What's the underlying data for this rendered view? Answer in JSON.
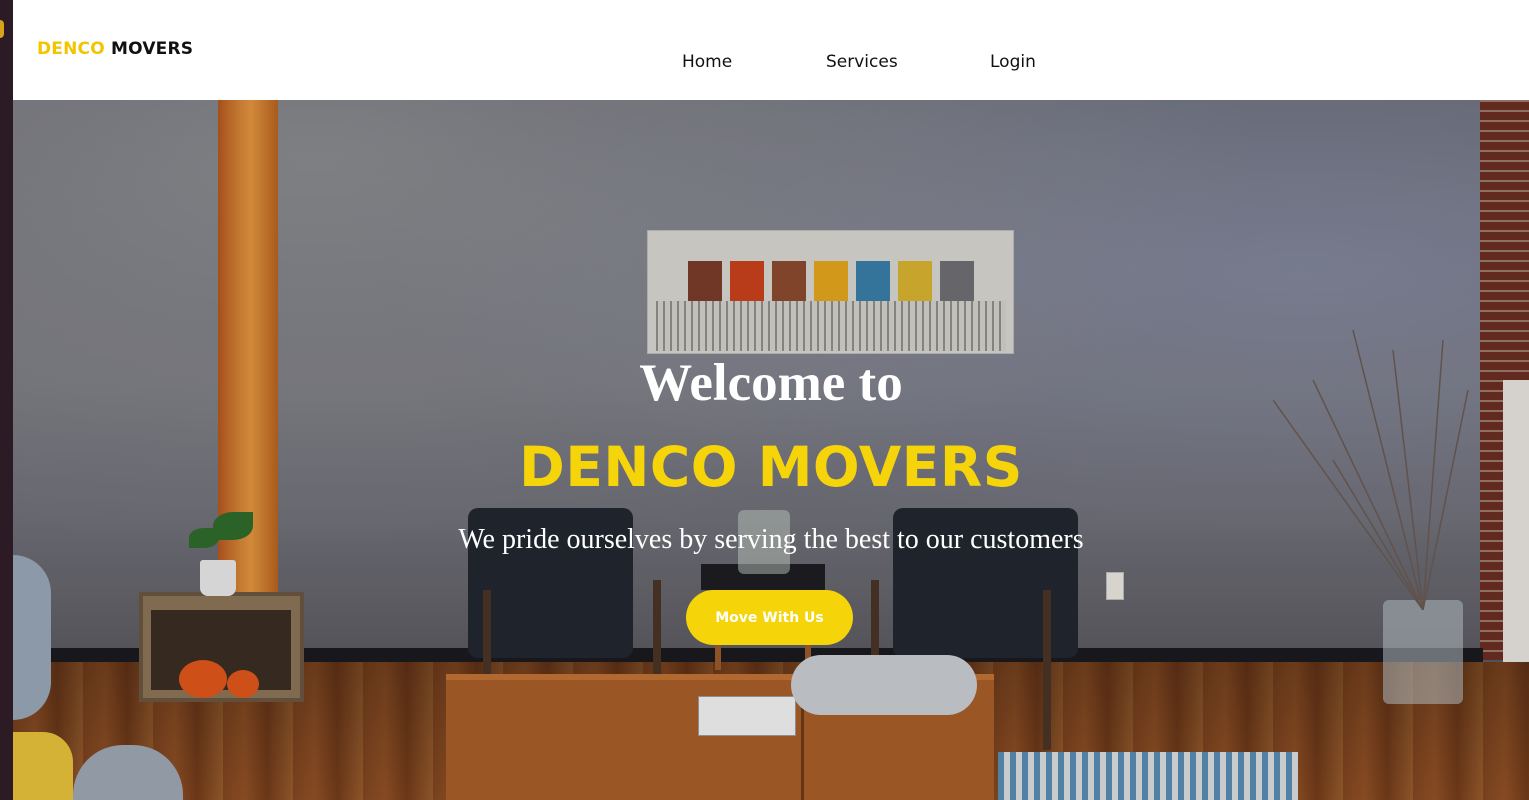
{
  "navbar": {
    "brand_part1": "DENCO",
    "brand_part2": "MOVERS",
    "links": [
      {
        "label": "Home"
      },
      {
        "label": "Services"
      },
      {
        "label": "Login"
      }
    ]
  },
  "hero": {
    "title": "Welcome to",
    "brand": "DENCO MOVERS",
    "tagline": "We pride ourselves by serving the best to our customers",
    "cta_label": "Move With Us"
  },
  "colors": {
    "accent": "#f6d40a",
    "nav_text": "#111111",
    "navbar_bg": "#ffffff"
  }
}
